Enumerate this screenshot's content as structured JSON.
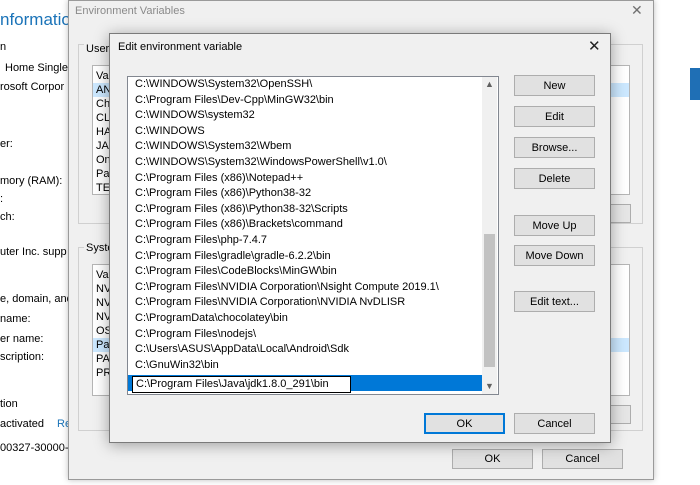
{
  "system_info": {
    "title": "nformation",
    "rows": [
      "n",
      "Home Single",
      "rosoft Corpor",
      "er:",
      "mory (RAM):",
      ":",
      "ch:",
      "uter Inc. supp",
      "e, domain, and",
      "name:",
      "er name:",
      "scription:",
      "tion",
      "activated",
      "00327-30000-"
    ],
    "link_fragment": "Re"
  },
  "env_window": {
    "title": "Environment Variables",
    "user_group_label": "User",
    "system_group_label": "Syste",
    "user_list_col": "Va",
    "user_list_rows": [
      "AN",
      "Ch",
      "CL",
      "HA",
      "JA",
      "On",
      "Pa",
      "TE"
    ],
    "system_list_col": "Va",
    "system_list_rows": [
      "NV",
      "NV",
      "NV",
      "OS",
      "Pa",
      "PA",
      "PR"
    ],
    "ok_label": "OK",
    "cancel_label": "Cancel"
  },
  "edit_dialog": {
    "title": "Edit environment variable",
    "paths": [
      "C:\\WINDOWS\\System32\\OpenSSH\\",
      "C:\\Program Files\\Dev-Cpp\\MinGW32\\bin",
      "C:\\WINDOWS\\system32",
      "C:\\WINDOWS",
      "C:\\WINDOWS\\System32\\Wbem",
      "C:\\WINDOWS\\System32\\WindowsPowerShell\\v1.0\\",
      "C:\\Program Files (x86)\\Notepad++",
      "C:\\Program Files (x86)\\Python38-32",
      "C:\\Program Files (x86)\\Python38-32\\Scripts",
      "C:\\Program Files (x86)\\Brackets\\command",
      "C:\\Program Files\\php-7.4.7",
      "C:\\Program Files\\gradle\\gradle-6.2.2\\bin",
      "C:\\Program Files\\CodeBlocks\\MinGW\\bin",
      "C:\\Program Files\\NVIDIA Corporation\\Nsight Compute 2019.1\\",
      "C:\\Program Files\\NVIDIA Corporation\\NVIDIA NvDLISR",
      "C:\\ProgramData\\chocolatey\\bin",
      "C:\\Program Files\\nodejs\\",
      "C:\\Users\\ASUS\\AppData\\Local\\Android\\Sdk",
      "C:\\GnuWin32\\bin"
    ],
    "editing_value": "C:\\Program Files\\Java\\jdk1.8.0_291\\bin",
    "buttons": {
      "new": "New",
      "edit": "Edit",
      "browse": "Browse...",
      "delete": "Delete",
      "move_up": "Move Up",
      "move_down": "Move Down",
      "edit_text": "Edit text...",
      "ok": "OK",
      "cancel": "Cancel"
    },
    "icons": {
      "close": "close-icon",
      "scroll_up": "scroll-up-icon",
      "scroll_down": "scroll-down-icon"
    }
  },
  "colors": {
    "selection": "#0078d7",
    "link": "#1a73b8",
    "dialog_bg": "#f0f0f0"
  }
}
